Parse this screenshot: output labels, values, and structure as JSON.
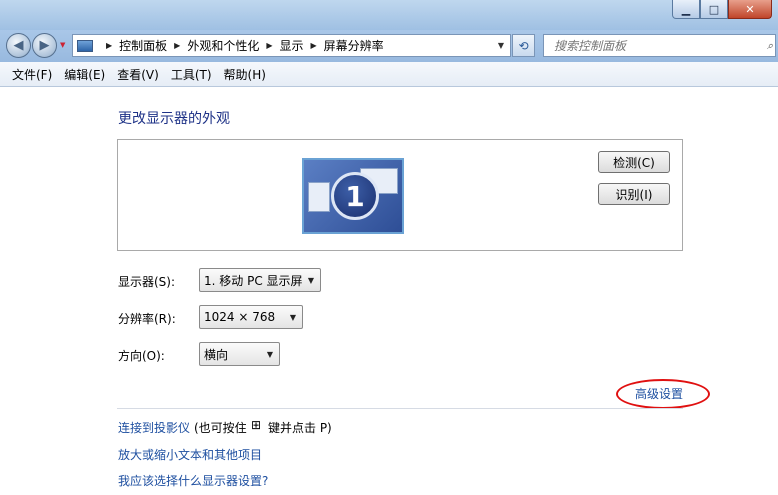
{
  "window": {
    "min_glyph": "▁",
    "max_glyph": "□",
    "close_glyph": "✕"
  },
  "nav": {
    "back_glyph": "◀",
    "forward_glyph": "▶",
    "breadcrumbs": [
      "控制面板",
      "外观和个性化",
      "显示",
      "屏幕分辨率"
    ],
    "search_placeholder": "搜索控制面板"
  },
  "menu": [
    "文件(F)",
    "编辑(E)",
    "查看(V)",
    "工具(T)",
    "帮助(H)"
  ],
  "main": {
    "heading": "更改显示器的外观",
    "monitor_number": "1",
    "detect_button": "检测(C)",
    "identify_button": "识别(I)",
    "display_label": "显示器(S):",
    "display_value": "1. 移动 PC 显示屏",
    "resolution_label": "分辨率(R):",
    "resolution_value": "1024 × 768",
    "orientation_label": "方向(O):",
    "orientation_value": "横向",
    "advanced_link": "高级设置",
    "projector_link": "连接到投影仪",
    "projector_hint_prefix": "(也可按住",
    "projector_hint_suffix": "键并点击 P)",
    "text_size_link": "放大或缩小文本和其他项目",
    "which_settings_link": "我应该选择什么显示器设置?"
  },
  "icons": {
    "windows_key": "windows-logo-icon",
    "search": "search-icon",
    "refresh": "refresh-icon"
  }
}
